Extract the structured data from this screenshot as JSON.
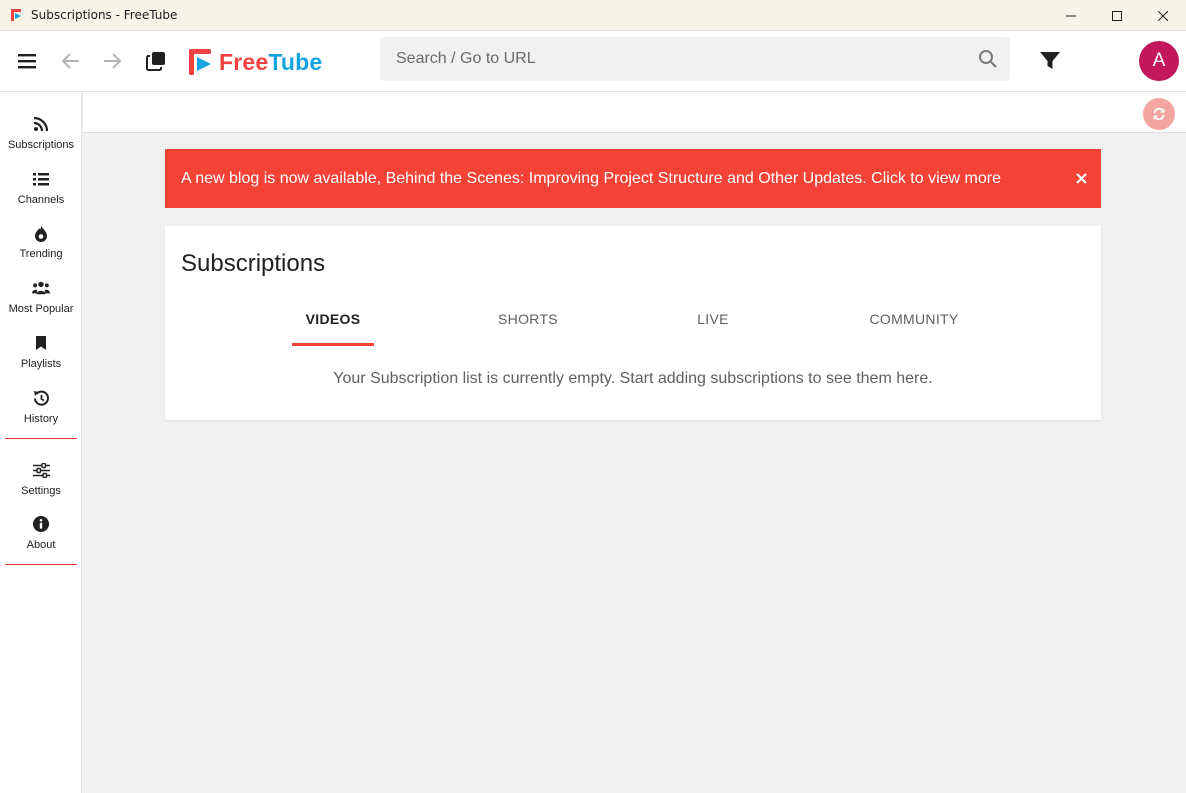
{
  "window": {
    "title": "Subscriptions - FreeTube"
  },
  "topnav": {
    "logo_part1": "Free",
    "logo_part2": "Tube",
    "search_placeholder": "Search / Go to URL",
    "avatar_letter": "A"
  },
  "sidebar": {
    "items": [
      {
        "label": "Subscriptions",
        "icon": "rss-icon"
      },
      {
        "label": "Channels",
        "icon": "list-icon"
      },
      {
        "label": "Trending",
        "icon": "fire-icon"
      },
      {
        "label": "Most Popular",
        "icon": "users-icon"
      },
      {
        "label": "Playlists",
        "icon": "bookmark-icon"
      },
      {
        "label": "History",
        "icon": "history-icon"
      },
      {
        "label": "Settings",
        "icon": "sliders-icon"
      },
      {
        "label": "About",
        "icon": "info-icon"
      }
    ]
  },
  "banner": {
    "text": "A new blog is now available, Behind the Scenes: Improving Project Structure and Other Updates. Click to view more"
  },
  "main": {
    "title": "Subscriptions",
    "tabs": [
      {
        "label": "VIDEOS",
        "active": true
      },
      {
        "label": "SHORTS",
        "active": false
      },
      {
        "label": "LIVE",
        "active": false
      },
      {
        "label": "COMMUNITY",
        "active": false
      }
    ],
    "empty_message": "Your Subscription list is currently empty. Start adding subscriptions to see them here."
  },
  "colors": {
    "accent_red": "#f44336",
    "logo_red": "#f04242",
    "logo_blue": "#14a4df",
    "avatar_bg": "#c2185b",
    "refresh_bg": "#f5a5a1"
  }
}
